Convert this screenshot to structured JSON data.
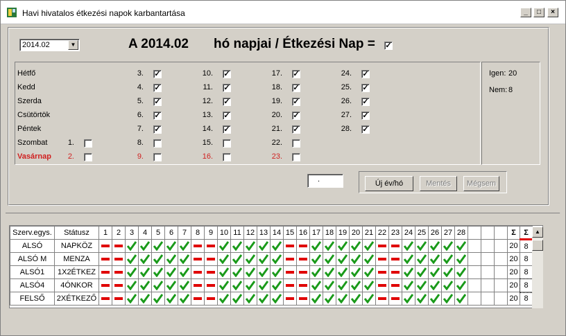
{
  "window": {
    "title": "Havi hivatalos étkezési napok karbantartása",
    "min": "_",
    "max": "□",
    "close": "×"
  },
  "month_select": {
    "value": "2014.02"
  },
  "header": {
    "prefix": "A 2014.02",
    "suffix": "hó napjai / Étkezési Nap =",
    "checked": true
  },
  "weekdays": [
    "Hétfő",
    "Kedd",
    "Szerda",
    "Csütörtök",
    "Péntek",
    "Szombat",
    "Vasárnap"
  ],
  "days": [
    {
      "n": "1.",
      "c": false,
      "w": 5
    },
    {
      "n": "2.",
      "c": false,
      "w": 6
    },
    {
      "n": "3.",
      "c": true,
      "w": 0
    },
    {
      "n": "4.",
      "c": true,
      "w": 1
    },
    {
      "n": "5.",
      "c": true,
      "w": 2
    },
    {
      "n": "6.",
      "c": true,
      "w": 3
    },
    {
      "n": "7.",
      "c": true,
      "w": 4
    },
    {
      "n": "8.",
      "c": false,
      "w": 5
    },
    {
      "n": "9.",
      "c": false,
      "w": 6
    },
    {
      "n": "10.",
      "c": true,
      "w": 0
    },
    {
      "n": "11.",
      "c": true,
      "w": 1
    },
    {
      "n": "12.",
      "c": true,
      "w": 2
    },
    {
      "n": "13.",
      "c": true,
      "w": 3
    },
    {
      "n": "14.",
      "c": true,
      "w": 4
    },
    {
      "n": "15.",
      "c": false,
      "w": 5
    },
    {
      "n": "16.",
      "c": false,
      "w": 6
    },
    {
      "n": "17.",
      "c": true,
      "w": 0
    },
    {
      "n": "18.",
      "c": true,
      "w": 1
    },
    {
      "n": "19.",
      "c": true,
      "w": 2
    },
    {
      "n": "20.",
      "c": true,
      "w": 3
    },
    {
      "n": "21.",
      "c": true,
      "w": 4
    },
    {
      "n": "22.",
      "c": false,
      "w": 5
    },
    {
      "n": "23.",
      "c": false,
      "w": 6
    },
    {
      "n": "24.",
      "c": true,
      "w": 0
    },
    {
      "n": "25.",
      "c": true,
      "w": 1
    },
    {
      "n": "26.",
      "c": true,
      "w": 2
    },
    {
      "n": "27.",
      "c": true,
      "w": 3
    },
    {
      "n": "28.",
      "c": true,
      "w": 4
    }
  ],
  "summary": {
    "igen_label": "Igen:",
    "igen_value": "20",
    "nem_label": "Nem:",
    "nem_value": "8"
  },
  "small_input": {
    "value": "."
  },
  "buttons": {
    "new": "Új év/hó",
    "save": "Mentés",
    "cancel": "Mégsem"
  },
  "grid": {
    "col_unit": "Szerv.egys.",
    "col_status": "Státusz",
    "day_headers": [
      "1",
      "2",
      "3",
      "4",
      "5",
      "6",
      "7",
      "8",
      "9",
      "10",
      "11",
      "12",
      "13",
      "14",
      "15",
      "16",
      "17",
      "18",
      "19",
      "20",
      "21",
      "22",
      "23",
      "24",
      "25",
      "26",
      "27",
      "28"
    ],
    "sum_yes": "Σ",
    "sum_no": "Σ",
    "pattern": [
      0,
      0,
      1,
      1,
      1,
      1,
      1,
      0,
      0,
      1,
      1,
      1,
      1,
      1,
      0,
      0,
      1,
      1,
      1,
      1,
      1,
      0,
      0,
      1,
      1,
      1,
      1,
      1
    ],
    "rows": [
      {
        "unit": "ALSÓ",
        "status": "NAPKÖZ",
        "yes": "20",
        "no": "8"
      },
      {
        "unit": "ALSÓ M",
        "status": "MENZA",
        "yes": "20",
        "no": "8"
      },
      {
        "unit": "ALSÓ1",
        "status": "1X2ÉTKEZ",
        "yes": "20",
        "no": "8"
      },
      {
        "unit": "ALSÓ4",
        "status": "4ÓNKOR",
        "yes": "20",
        "no": "8"
      },
      {
        "unit": "FELSŐ",
        "status": "2XÉTKEZŐ",
        "yes": "20",
        "no": "8"
      }
    ]
  },
  "colors": {
    "check": "#1a9a1a",
    "no": "#e00000",
    "sunday": "#d02020"
  }
}
